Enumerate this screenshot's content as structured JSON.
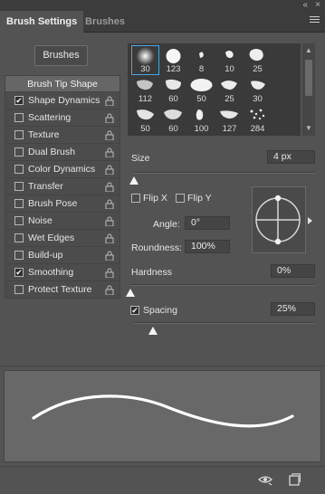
{
  "panel": {
    "tabs": [
      {
        "label": "Brush Settings",
        "active": true
      },
      {
        "label": "Brushes",
        "active": false
      }
    ],
    "icons": [
      "collapse-double-arrow-icon",
      "close-icon",
      "panel-menu-icon"
    ]
  },
  "brushes_button": "Brushes",
  "settings_list": [
    {
      "label": "Brush Tip Shape",
      "header": true
    },
    {
      "label": "Shape Dynamics",
      "checked": true,
      "lock": true
    },
    {
      "label": "Scattering",
      "checked": false,
      "lock": true
    },
    {
      "label": "Texture",
      "checked": false,
      "lock": true
    },
    {
      "label": "Dual Brush",
      "checked": false,
      "lock": true
    },
    {
      "label": "Color Dynamics",
      "checked": false,
      "lock": true
    },
    {
      "label": "Transfer",
      "checked": false,
      "lock": true
    },
    {
      "label": "Brush Pose",
      "checked": false,
      "lock": true
    },
    {
      "label": "Noise",
      "checked": false,
      "lock": true
    },
    {
      "label": "Wet Edges",
      "checked": false,
      "lock": true
    },
    {
      "label": "Build-up",
      "checked": false,
      "lock": true
    },
    {
      "label": "Smoothing",
      "checked": true,
      "lock": true
    },
    {
      "label": "Protect Texture",
      "checked": false,
      "lock": true
    }
  ],
  "presets": [
    {
      "size": "30",
      "selected": true
    },
    {
      "size": "123"
    },
    {
      "size": "8"
    },
    {
      "size": "10"
    },
    {
      "size": "25"
    },
    {
      "size": "112"
    },
    {
      "size": "60"
    },
    {
      "size": "50"
    },
    {
      "size": "25"
    },
    {
      "size": "30"
    },
    {
      "size": "50"
    },
    {
      "size": "60"
    },
    {
      "size": "100"
    },
    {
      "size": "127"
    },
    {
      "size": "284"
    }
  ],
  "size": {
    "label": "Size",
    "value": "4 px",
    "level": 0.0
  },
  "flip_x": {
    "label": "Flip X",
    "checked": false
  },
  "flip_y": {
    "label": "Flip Y",
    "checked": false
  },
  "angle": {
    "label": "Angle:",
    "value": "0°"
  },
  "roundness": {
    "label": "Roundness:",
    "value": "100%"
  },
  "hardness": {
    "label": "Hardness",
    "value": "0%",
    "level": 0.0
  },
  "spacing": {
    "label": "Spacing",
    "value": "25%",
    "checked": true,
    "level": 0.25
  },
  "bottom_icons": [
    "eye-toggle-icon",
    "new-preset-icon"
  ],
  "colors": {
    "accent": "#4aa3e0",
    "panel_bg": "#535353",
    "preview_bg": "#686868"
  }
}
